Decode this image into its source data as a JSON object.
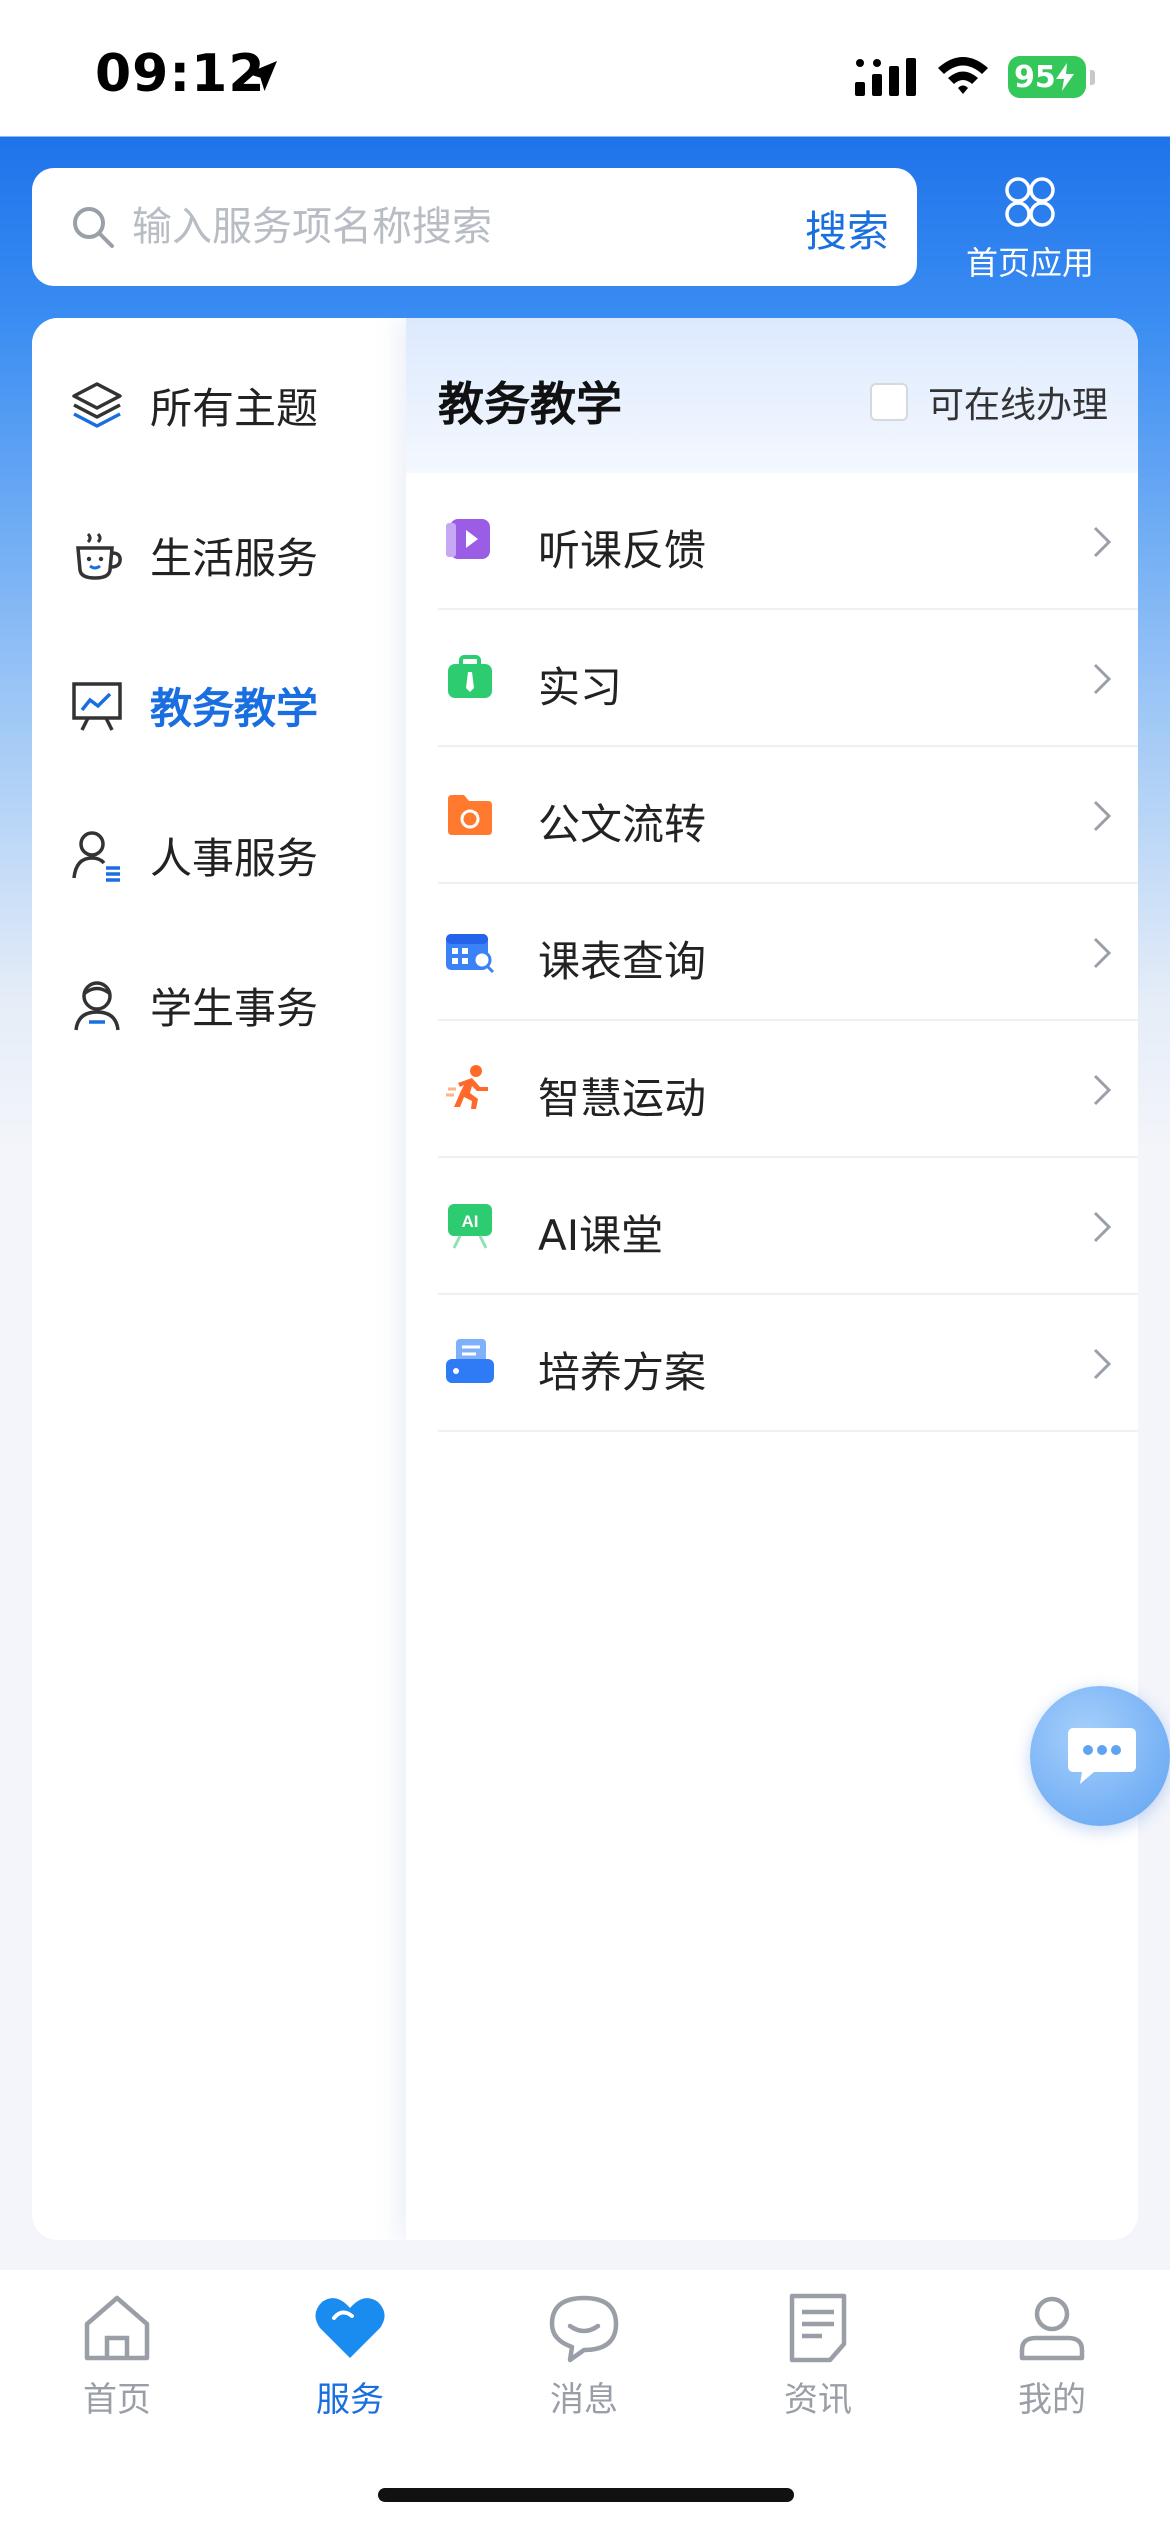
{
  "status_bar": {
    "time": "09:12",
    "battery": "95"
  },
  "search": {
    "placeholder": "输入服务项名称搜索",
    "button_label": "搜索"
  },
  "home_apps": {
    "label": "首页应用"
  },
  "sidebar": {
    "items": [
      {
        "label": "所有主题",
        "icon": "layers-icon"
      },
      {
        "label": "生活服务",
        "icon": "coffee-cup-icon"
      },
      {
        "label": "教务教学",
        "icon": "presentation-board-icon",
        "active": true
      },
      {
        "label": "人事服务",
        "icon": "person-list-icon"
      },
      {
        "label": "学生事务",
        "icon": "student-icon"
      }
    ]
  },
  "content": {
    "title": "教务教学",
    "online_only_label": "可在线办理",
    "items": [
      {
        "label": "听课反馈",
        "icon": "video-feedback-icon",
        "color": "#9b5de5"
      },
      {
        "label": "实习",
        "icon": "briefcase-icon",
        "color": "#2ecc71"
      },
      {
        "label": "公文流转",
        "icon": "folder-cycle-icon",
        "color": "#ff7a2f"
      },
      {
        "label": "课表查询",
        "icon": "calendar-search-icon",
        "color": "#3b82f6"
      },
      {
        "label": "智慧运动",
        "icon": "running-person-icon",
        "color": "#ff6a2b"
      },
      {
        "label": "AI课堂",
        "icon": "ai-board-icon",
        "color": "#2ecc71"
      },
      {
        "label": "培养方案",
        "icon": "plan-document-icon",
        "color": "#2f7bf5"
      }
    ]
  },
  "tabs": [
    {
      "label": "首页",
      "icon": "home-icon"
    },
    {
      "label": "服务",
      "icon": "heart-service-icon",
      "active": true
    },
    {
      "label": "消息",
      "icon": "chat-bubble-icon"
    },
    {
      "label": "资讯",
      "icon": "news-document-icon"
    },
    {
      "label": "我的",
      "icon": "profile-icon"
    }
  ],
  "colors": {
    "accent": "#1a6fe0",
    "header_blue": "#1f73ea",
    "inactive_tab": "#9a9ea6"
  }
}
